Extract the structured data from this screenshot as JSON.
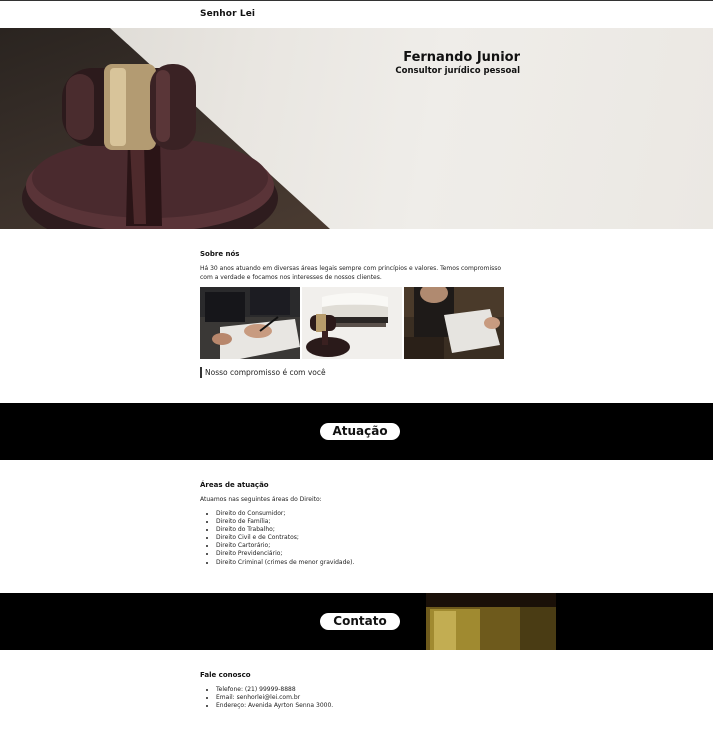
{
  "header": {
    "brand": "Senhor Lei"
  },
  "hero": {
    "name": "Fernando Junior",
    "subtitle": "Consultor jurídico pessoal"
  },
  "about": {
    "heading": "Sobre nós",
    "text": "Há 30 anos atuando em diversas áreas legais sempre com princípios e valores. Temos compromisso com a verdade e focamos nos interesses de nossos clientes.",
    "quote": "Nosso compromisso é com você"
  },
  "banners": {
    "atuacao": "Atuação",
    "contato": "Contato"
  },
  "areas": {
    "heading": "Áreas de atuação",
    "intro": "Atuamos nas seguintes áreas do Direito:",
    "items": [
      "Direito do Consumidor;",
      "Direito de Família;",
      "Direito do Trabalho;",
      "Direito Civil e de Contratos;",
      "Direito Cartorário;",
      "Direito Previdenciário;",
      "Direito Criminal (crimes de menor gravidade)."
    ]
  },
  "contact": {
    "heading": "Fale conosco",
    "items": [
      "Telefone: (21) 99999-8888",
      "Email: senhorlei@lei.com.br",
      "Endereço: Avenida Ayrton Senna 3000."
    ]
  }
}
